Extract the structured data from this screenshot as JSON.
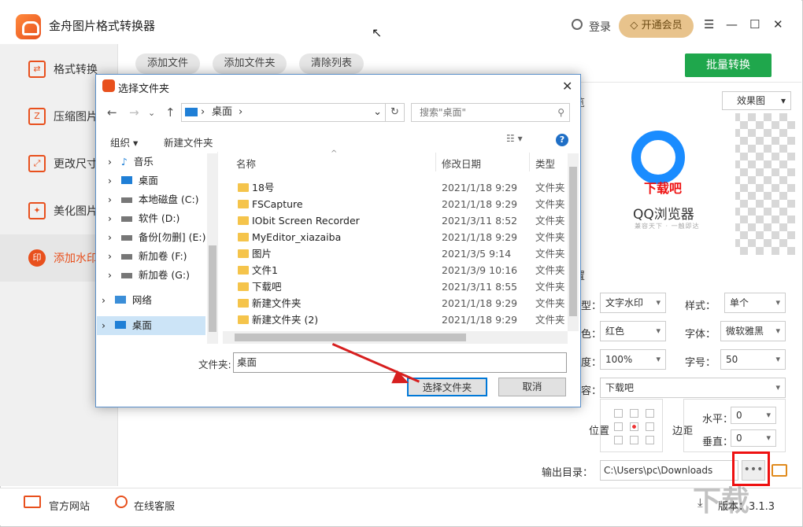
{
  "app": {
    "title": "金舟图片格式转换器",
    "login": "登录",
    "vip": "开通会员",
    "controls": [
      "☰",
      "—",
      "☐",
      "✕"
    ]
  },
  "sidebar": {
    "items": [
      {
        "label": "格式转换",
        "icon": "format-convert-icon"
      },
      {
        "label": "压缩图片",
        "icon": "compress-icon"
      },
      {
        "label": "更改尺寸",
        "icon": "resize-icon"
      },
      {
        "label": "美化图片",
        "icon": "beautify-icon"
      },
      {
        "label": "添加水印",
        "icon": "watermark-icon",
        "active": true
      }
    ]
  },
  "toolbar": {
    "add_file": "添加文件",
    "add_folder": "添加文件夹",
    "clear_list": "清除列表",
    "batch_convert": "批量转换"
  },
  "preview": {
    "label": "览",
    "effect": "效果图",
    "watermark": "下载吧",
    "product": "QQ浏览器",
    "slogan": "兼容天下 · 一触即达"
  },
  "settings": {
    "title": "置",
    "type_label": "型：",
    "type_value": "文字水印",
    "style_label": "样式：",
    "style_value": "单个",
    "color_label": "色：",
    "color_value": "红色",
    "font_label": "字体：",
    "font_value": "微软雅黑",
    "opacity_label": "度：",
    "opacity_value": "100%",
    "size_label": "字号：",
    "size_value": "50",
    "text_label": "容：",
    "text_value": "下载吧",
    "position_label": "位置",
    "margin_label": "边距",
    "h_label": "水平：",
    "h_value": "0",
    "v_label": "垂直：",
    "v_value": "0",
    "output_label": "输出目录：",
    "output_value": "C:\\Users\\pc\\Downloads",
    "dots": "•••"
  },
  "footer": {
    "site": "官方网站",
    "service": "在线客服",
    "version": "版本：3.1.3"
  },
  "dialog": {
    "title": "选择文件夹",
    "address": "桌面",
    "address_sep": "›",
    "search_placeholder": "搜索\"桌面\"",
    "organize": "组织 ▾",
    "new_folder": "新建文件夹",
    "tree": [
      {
        "label": "音乐",
        "icon": "music-icon"
      },
      {
        "label": "桌面",
        "icon": "desktop-icon"
      },
      {
        "label": "本地磁盘 (C:)",
        "icon": "drive-icon"
      },
      {
        "label": "软件 (D:)",
        "icon": "drive-icon"
      },
      {
        "label": "备份[勿删] (E:)",
        "icon": "drive-icon"
      },
      {
        "label": "新加卷 (F:)",
        "icon": "drive-icon"
      },
      {
        "label": "新加卷 (G:)",
        "icon": "drive-icon"
      },
      {
        "label": "网络",
        "icon": "network-icon"
      },
      {
        "label": "桌面",
        "icon": "desktop-icon"
      }
    ],
    "columns": {
      "name": "名称",
      "date": "修改日期",
      "type": "类型"
    },
    "rows": [
      {
        "name": "18号",
        "date": "2021/1/18 9:29",
        "type": "文件夹"
      },
      {
        "name": "FSCapture",
        "date": "2021/1/18 9:29",
        "type": "文件夹"
      },
      {
        "name": "IObit Screen Recorder",
        "date": "2021/3/11 8:52",
        "type": "文件夹"
      },
      {
        "name": "MyEditor_xiazaiba",
        "date": "2021/1/18 9:29",
        "type": "文件夹"
      },
      {
        "name": "图片",
        "date": "2021/3/5 9:14",
        "type": "文件夹"
      },
      {
        "name": "文件1",
        "date": "2021/3/9 10:16",
        "type": "文件夹"
      },
      {
        "name": "下载吧",
        "date": "2021/3/11 8:55",
        "type": "文件夹"
      },
      {
        "name": "新建文件夹",
        "date": "2021/1/18 9:29",
        "type": "文件夹"
      },
      {
        "name": "新建文件夹 (2)",
        "date": "2021/1/18 9:29",
        "type": "文件夹"
      }
    ],
    "folder_label": "文件夹:",
    "folder_value": "桌面",
    "ok": "选择文件夹",
    "cancel": "取消"
  },
  "corner_watermark": "下载"
}
